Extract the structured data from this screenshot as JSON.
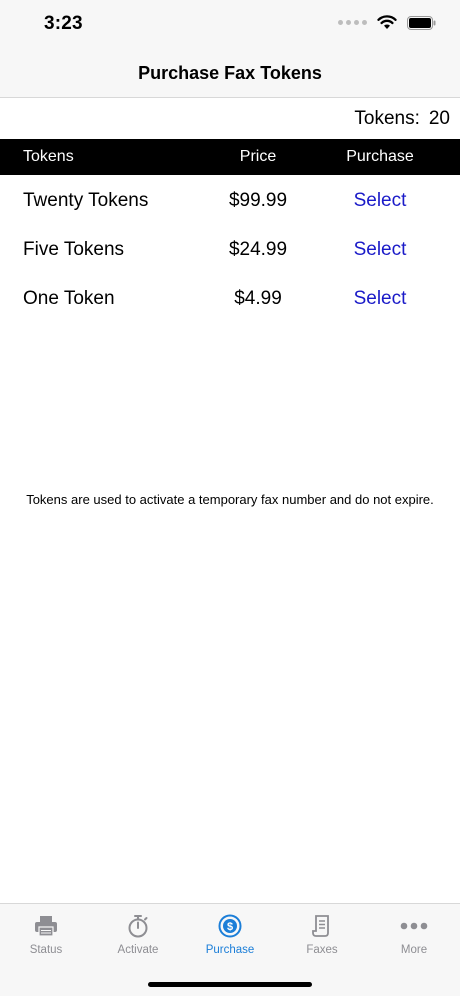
{
  "status_bar": {
    "time": "3:23"
  },
  "nav": {
    "title": "Purchase Fax Tokens"
  },
  "balance": {
    "label": "Tokens:",
    "count": "20"
  },
  "table": {
    "headers": {
      "tokens": "Tokens",
      "price": "Price",
      "purchase": "Purchase"
    },
    "rows": [
      {
        "name": "Twenty Tokens",
        "price": "$99.99",
        "action": "Select"
      },
      {
        "name": "Five Tokens",
        "price": "$24.99",
        "action": "Select"
      },
      {
        "name": "One Token",
        "price": "$4.99",
        "action": "Select"
      }
    ]
  },
  "note": "Tokens are used to activate a temporary fax number and do not expire.",
  "tabs": [
    {
      "label": "Status",
      "icon": "printer-icon",
      "active": false
    },
    {
      "label": "Activate",
      "icon": "stopwatch-icon",
      "active": false
    },
    {
      "label": "Purchase",
      "icon": "dollar-coin-icon",
      "active": true
    },
    {
      "label": "Faxes",
      "icon": "receipt-icon",
      "active": false
    },
    {
      "label": "More",
      "icon": "more-dots-icon",
      "active": false
    }
  ],
  "colors": {
    "accent": "#1b7ed8",
    "link": "#1a1ac8",
    "header_bg": "#000000",
    "inactive": "#8e8e93"
  }
}
